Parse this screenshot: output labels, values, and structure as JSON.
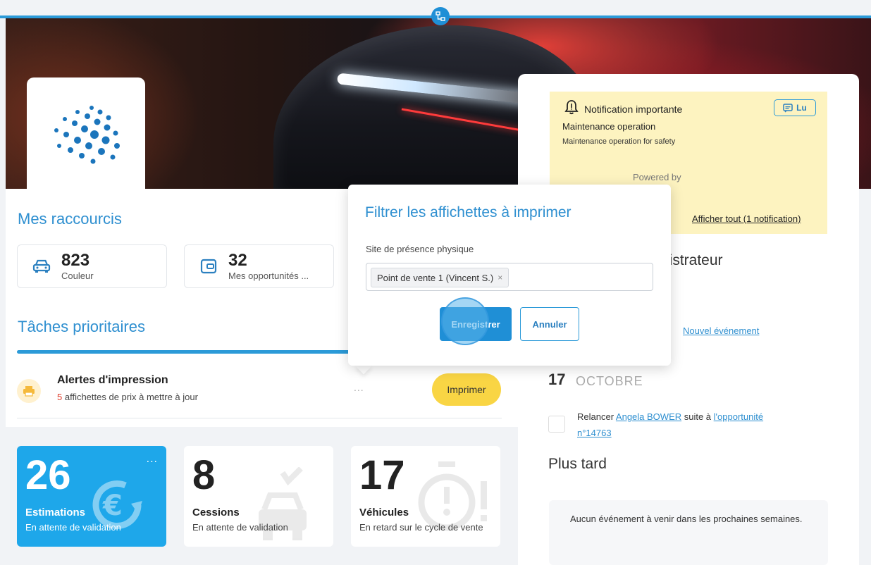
{
  "header": {
    "handle_icon": "network-icon"
  },
  "shortcuts": {
    "title": "Mes raccourcis",
    "items": [
      {
        "value": "823",
        "label": "Couleur",
        "icon": "car-icon"
      },
      {
        "value": "32",
        "label": "Mes opportunités ...",
        "icon": "wallet-icon"
      }
    ]
  },
  "tasks": {
    "title": "Tâches prioritaires",
    "alert": {
      "title": "Alertes d'impression",
      "count": "5",
      "text": " affichettes de prix à mettre à jour",
      "more": "...",
      "button": "Imprimer",
      "icon": "printer-icon"
    }
  },
  "stats": [
    {
      "value": "26",
      "title": "Estimations",
      "subtitle": "En attente de validation",
      "icon": "euro-refresh-icon",
      "more": "..."
    },
    {
      "value": "8",
      "title": "Cessions",
      "subtitle": "En attente de validation",
      "icon": "car-check-icon"
    },
    {
      "value": "17",
      "title": "Véhicules",
      "subtitle": "En retard sur le cycle de vente",
      "icon": "stopwatch-alert-icon"
    }
  ],
  "notification": {
    "title": "Notification importante",
    "heading": "Maintenance operation",
    "subtitle": "Maintenance operation for safety",
    "lu_button": "Lu",
    "powered": "Powered by",
    "show_all": "Afficher tout (1 notification)"
  },
  "agenda": {
    "admin_label": "nistrateur",
    "new_event": "Nouvel événement",
    "date_day": "17",
    "date_month": "OCTOBRE",
    "task_prefix": "Relancer ",
    "task_person": "Angela BOWER",
    "task_mid": " suite à ",
    "task_link": "l'opportunité n°14763",
    "later_title": "Plus tard",
    "no_events": "Aucun événement à venir dans les prochaines semaines."
  },
  "modal": {
    "title": "Filtrer les affichettes à imprimer",
    "field_label": "Site de présence physique",
    "selected_tag": "Point de vente 1 (Vincent S.)",
    "tag_remove": "×",
    "save": "Enregistrer",
    "cancel": "Annuler"
  },
  "colors": {
    "accent": "#2b9ad8",
    "title_blue": "#2e8fd0",
    "print_yellow": "#f9d544",
    "stat_blue": "#1ea7ea",
    "notification_bg": "#fdf3c0"
  }
}
